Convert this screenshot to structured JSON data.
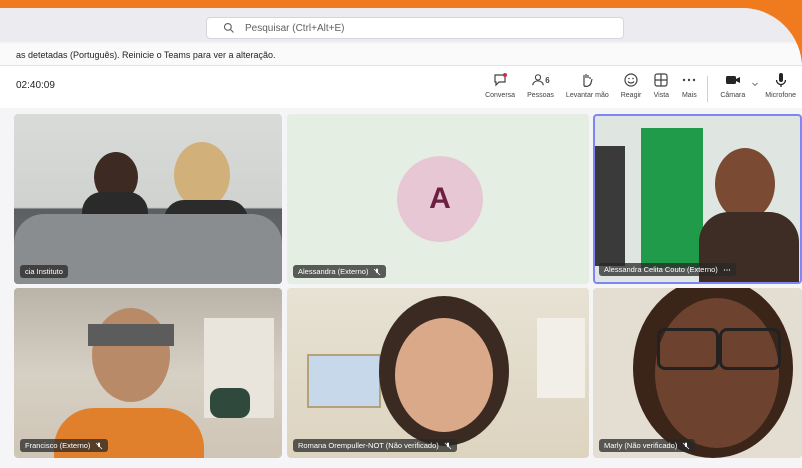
{
  "search": {
    "placeholder": "Pesquisar (Ctrl+Alt+E)"
  },
  "banner": {
    "text": "as detetadas (Português). Reinicie o Teams para ver a alteração."
  },
  "meeting": {
    "timer": "02:40:09"
  },
  "toolbar": {
    "chat": "Conversa",
    "people": "Pessoas",
    "people_count": "6",
    "raise_hand": "Levantar mão",
    "react": "Reagir",
    "view": "Vista",
    "more": "Mais",
    "camera": "Câmara",
    "mic": "Microfone"
  },
  "participants": [
    {
      "name": "cia Instituto"
    },
    {
      "name": "Alessandra (Externo)",
      "initial": "A"
    },
    {
      "name": "Alessandra Celita Couto (Externo)"
    },
    {
      "name": "Francisco (Externo)"
    },
    {
      "name": "Romana Orempuller-NOT (Não verificado)"
    },
    {
      "name": "Marly (Não verificado)"
    }
  ],
  "colors": {
    "accent": "#f07a1e",
    "active_border": "#7f85f5",
    "avatar_bg": "#e8c7d4"
  }
}
